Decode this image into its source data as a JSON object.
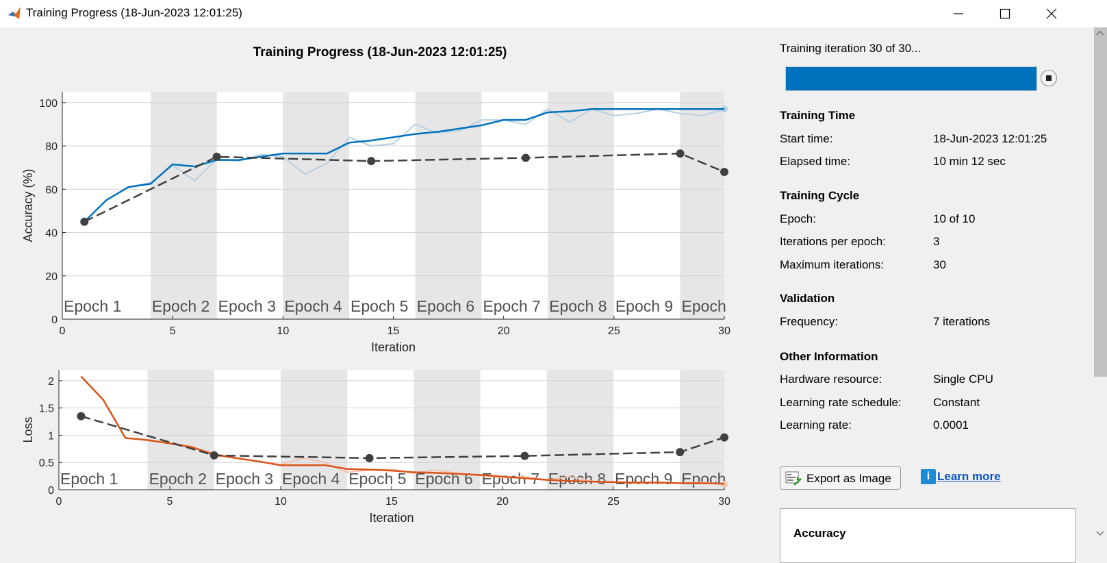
{
  "window": {
    "title": "Training Progress (18-Jun-2023 12:01:25)",
    "icons": [
      "matlab-logo-icon",
      "minimize-icon",
      "maximize-icon",
      "close-icon"
    ]
  },
  "plots": {
    "title": "Training Progress (18-Jun-2023 12:01:25)"
  },
  "chart_data": [
    {
      "type": "line",
      "xlabel": "Iteration",
      "ylabel": "Accuracy (%)",
      "xlim": [
        0,
        30
      ],
      "ylim": [
        0,
        105
      ],
      "xticks": [
        0,
        5,
        10,
        15,
        20,
        25,
        30
      ],
      "yticks": [
        0,
        20,
        40,
        60,
        80,
        100
      ],
      "grid": true,
      "epoch_bands": [
        [
          4,
          7
        ],
        [
          10,
          13
        ],
        [
          16,
          19
        ],
        [
          22,
          25
        ],
        [
          28,
          30
        ]
      ],
      "epoch_labels": [
        {
          "text": "Epoch 1",
          "x": 0
        },
        {
          "text": "Epoch 2",
          "x": 4
        },
        {
          "text": "Epoch 3",
          "x": 7
        },
        {
          "text": "Epoch 4",
          "x": 10
        },
        {
          "text": "Epoch 5",
          "x": 13
        },
        {
          "text": "Epoch 6",
          "x": 16
        },
        {
          "text": "Epoch 7",
          "x": 19
        },
        {
          "text": "Epoch 8",
          "x": 22
        },
        {
          "text": "Epoch 9",
          "x": 25
        },
        {
          "text": "Epoch",
          "x": 28
        }
      ],
      "series": [
        {
          "role": "raw",
          "color": "#b6cfe3",
          "x": [
            1,
            2,
            3,
            4,
            5,
            6,
            7,
            8,
            9,
            10,
            11,
            12,
            13,
            14,
            15,
            16,
            17,
            18,
            19,
            20,
            21,
            22,
            23,
            24,
            25,
            26,
            27,
            28,
            29,
            30
          ],
          "values": [
            45,
            55,
            61,
            63,
            71,
            64,
            74,
            73,
            76,
            75,
            67,
            72,
            84,
            80,
            81,
            90,
            86,
            87,
            92,
            92,
            90,
            97,
            91,
            97,
            94,
            95,
            97,
            95,
            94,
            97
          ]
        },
        {
          "role": "smoothed",
          "color": "#0072bd",
          "x": [
            1,
            2,
            3,
            4,
            5,
            6,
            7,
            8,
            9,
            10,
            11,
            12,
            13,
            14,
            15,
            16,
            17,
            18,
            19,
            20,
            21,
            22,
            23,
            24,
            25,
            26,
            27,
            28,
            29,
            30
          ],
          "values": [
            45,
            55,
            61,
            62.5,
            71.5,
            70.5,
            73.5,
            73.5,
            75,
            76.5,
            76.5,
            76.5,
            81.5,
            82.5,
            84,
            85.5,
            86.5,
            88,
            89.5,
            92,
            92,
            95.5,
            96,
            97,
            97,
            97,
            97,
            97,
            97,
            97
          ]
        },
        {
          "role": "validation",
          "color": "#404040",
          "x": [
            1,
            7,
            14,
            21,
            28,
            30
          ],
          "values": [
            45,
            75,
            73,
            74.5,
            76.5,
            68
          ]
        }
      ]
    },
    {
      "type": "line",
      "xlabel": "Iteration",
      "ylabel": "Loss",
      "xlim": [
        0,
        30
      ],
      "ylim": [
        0,
        2.2
      ],
      "xticks": [
        0,
        5,
        10,
        15,
        20,
        25,
        30
      ],
      "yticks": [
        0,
        0.5,
        1,
        1.5,
        2
      ],
      "ytick_labels": [
        "0",
        "0.5",
        "1",
        "1.5",
        "2"
      ],
      "grid": true,
      "epoch_bands": [
        [
          4,
          7
        ],
        [
          10,
          13
        ],
        [
          16,
          19
        ],
        [
          22,
          25
        ],
        [
          28,
          30
        ]
      ],
      "epoch_labels": [
        {
          "text": "Epoch 1",
          "x": 0
        },
        {
          "text": "Epoch 2",
          "x": 4
        },
        {
          "text": "Epoch 3",
          "x": 7
        },
        {
          "text": "Epoch 4",
          "x": 10
        },
        {
          "text": "Epoch 5",
          "x": 13
        },
        {
          "text": "Epoch 6",
          "x": 16
        },
        {
          "text": "Epoch 7",
          "x": 19
        },
        {
          "text": "Epoch 8",
          "x": 22
        },
        {
          "text": "Epoch 9",
          "x": 25
        },
        {
          "text": "Epoch",
          "x": 28
        }
      ],
      "series": [
        {
          "role": "raw",
          "color": "#f2c4ad",
          "x": [
            1,
            2,
            3,
            4,
            5,
            6,
            7,
            8,
            9,
            10,
            11,
            12,
            13,
            14,
            15,
            16,
            17,
            18,
            19,
            20,
            21,
            22,
            23,
            24,
            25,
            26,
            27,
            28,
            29,
            30
          ],
          "values": [
            2.08,
            1.65,
            0.95,
            0.92,
            0.85,
            0.8,
            0.62,
            0.58,
            0.52,
            0.46,
            0.58,
            0.5,
            0.32,
            0.36,
            0.38,
            0.3,
            0.36,
            0.3,
            0.26,
            0.22,
            0.24,
            0.18,
            0.24,
            0.16,
            0.14,
            0.12,
            0.14,
            0.12,
            0.14,
            0.1
          ]
        },
        {
          "role": "smoothed",
          "color": "#d95319",
          "x": [
            1,
            2,
            3,
            4,
            5,
            6,
            7,
            8,
            9,
            10,
            11,
            12,
            13,
            14,
            15,
            16,
            17,
            18,
            19,
            20,
            21,
            22,
            23,
            24,
            25,
            26,
            27,
            28,
            29,
            30
          ],
          "values": [
            2.08,
            1.65,
            0.95,
            0.91,
            0.85,
            0.78,
            0.65,
            0.58,
            0.52,
            0.45,
            0.45,
            0.45,
            0.38,
            0.37,
            0.35,
            0.32,
            0.31,
            0.29,
            0.27,
            0.24,
            0.21,
            0.18,
            0.16,
            0.15,
            0.14,
            0.13,
            0.13,
            0.12,
            0.12,
            0.11
          ]
        },
        {
          "role": "validation",
          "color": "#404040",
          "x": [
            1,
            7,
            14,
            21,
            28,
            30
          ],
          "values": [
            1.35,
            0.63,
            0.58,
            0.62,
            0.69,
            0.96
          ]
        }
      ]
    }
  ],
  "status": {
    "iteration_text": "Training iteration 30 of 30...",
    "progress": 1.0,
    "stop_icon": "stop-icon"
  },
  "training_time": {
    "heading": "Training Time",
    "start_label": "Start time:",
    "start_value": "18-Jun-2023 12:01:25",
    "elapsed_label": "Elapsed time:",
    "elapsed_value": "10 min 12 sec"
  },
  "training_cycle": {
    "heading": "Training Cycle",
    "epoch_label": "Epoch:",
    "epoch_value": "10 of 10",
    "ipe_label": "Iterations per epoch:",
    "ipe_value": "3",
    "maxit_label": "Maximum iterations:",
    "maxit_value": "30"
  },
  "validation": {
    "heading": "Validation",
    "freq_label": "Frequency:",
    "freq_value": "7 iterations"
  },
  "other_info": {
    "heading": "Other Information",
    "hw_label": "Hardware resource:",
    "hw_value": "Single CPU",
    "lrs_label": "Learning rate schedule:",
    "lrs_value": "Constant",
    "lr_label": "Learning rate:",
    "lr_value": "0.0001"
  },
  "actions": {
    "export_label": "Export as Image",
    "learn_more": "Learn more",
    "info_glyph": "i"
  },
  "legend_box": {
    "title": "Accuracy"
  }
}
